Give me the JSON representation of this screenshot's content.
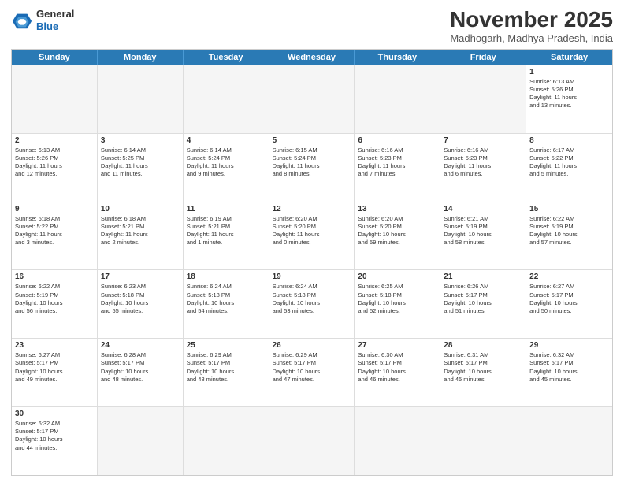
{
  "header": {
    "logo_general": "General",
    "logo_blue": "Blue",
    "month_title": "November 2025",
    "subtitle": "Madhogarh, Madhya Pradesh, India"
  },
  "day_headers": [
    "Sunday",
    "Monday",
    "Tuesday",
    "Wednesday",
    "Thursday",
    "Friday",
    "Saturday"
  ],
  "weeks": [
    [
      {
        "day": "",
        "info": ""
      },
      {
        "day": "",
        "info": ""
      },
      {
        "day": "",
        "info": ""
      },
      {
        "day": "",
        "info": ""
      },
      {
        "day": "",
        "info": ""
      },
      {
        "day": "",
        "info": ""
      },
      {
        "day": "1",
        "info": "Sunrise: 6:13 AM\nSunset: 5:26 PM\nDaylight: 11 hours\nand 13 minutes."
      }
    ],
    [
      {
        "day": "2",
        "info": "Sunrise: 6:13 AM\nSunset: 5:26 PM\nDaylight: 11 hours\nand 12 minutes."
      },
      {
        "day": "3",
        "info": "Sunrise: 6:14 AM\nSunset: 5:25 PM\nDaylight: 11 hours\nand 11 minutes."
      },
      {
        "day": "4",
        "info": "Sunrise: 6:14 AM\nSunset: 5:24 PM\nDaylight: 11 hours\nand 9 minutes."
      },
      {
        "day": "5",
        "info": "Sunrise: 6:15 AM\nSunset: 5:24 PM\nDaylight: 11 hours\nand 8 minutes."
      },
      {
        "day": "6",
        "info": "Sunrise: 6:16 AM\nSunset: 5:23 PM\nDaylight: 11 hours\nand 7 minutes."
      },
      {
        "day": "7",
        "info": "Sunrise: 6:16 AM\nSunset: 5:23 PM\nDaylight: 11 hours\nand 6 minutes."
      },
      {
        "day": "8",
        "info": "Sunrise: 6:17 AM\nSunset: 5:22 PM\nDaylight: 11 hours\nand 5 minutes."
      }
    ],
    [
      {
        "day": "9",
        "info": "Sunrise: 6:18 AM\nSunset: 5:22 PM\nDaylight: 11 hours\nand 3 minutes."
      },
      {
        "day": "10",
        "info": "Sunrise: 6:18 AM\nSunset: 5:21 PM\nDaylight: 11 hours\nand 2 minutes."
      },
      {
        "day": "11",
        "info": "Sunrise: 6:19 AM\nSunset: 5:21 PM\nDaylight: 11 hours\nand 1 minute."
      },
      {
        "day": "12",
        "info": "Sunrise: 6:20 AM\nSunset: 5:20 PM\nDaylight: 11 hours\nand 0 minutes."
      },
      {
        "day": "13",
        "info": "Sunrise: 6:20 AM\nSunset: 5:20 PM\nDaylight: 10 hours\nand 59 minutes."
      },
      {
        "day": "14",
        "info": "Sunrise: 6:21 AM\nSunset: 5:19 PM\nDaylight: 10 hours\nand 58 minutes."
      },
      {
        "day": "15",
        "info": "Sunrise: 6:22 AM\nSunset: 5:19 PM\nDaylight: 10 hours\nand 57 minutes."
      }
    ],
    [
      {
        "day": "16",
        "info": "Sunrise: 6:22 AM\nSunset: 5:19 PM\nDaylight: 10 hours\nand 56 minutes."
      },
      {
        "day": "17",
        "info": "Sunrise: 6:23 AM\nSunset: 5:18 PM\nDaylight: 10 hours\nand 55 minutes."
      },
      {
        "day": "18",
        "info": "Sunrise: 6:24 AM\nSunset: 5:18 PM\nDaylight: 10 hours\nand 54 minutes."
      },
      {
        "day": "19",
        "info": "Sunrise: 6:24 AM\nSunset: 5:18 PM\nDaylight: 10 hours\nand 53 minutes."
      },
      {
        "day": "20",
        "info": "Sunrise: 6:25 AM\nSunset: 5:18 PM\nDaylight: 10 hours\nand 52 minutes."
      },
      {
        "day": "21",
        "info": "Sunrise: 6:26 AM\nSunset: 5:17 PM\nDaylight: 10 hours\nand 51 minutes."
      },
      {
        "day": "22",
        "info": "Sunrise: 6:27 AM\nSunset: 5:17 PM\nDaylight: 10 hours\nand 50 minutes."
      }
    ],
    [
      {
        "day": "23",
        "info": "Sunrise: 6:27 AM\nSunset: 5:17 PM\nDaylight: 10 hours\nand 49 minutes."
      },
      {
        "day": "24",
        "info": "Sunrise: 6:28 AM\nSunset: 5:17 PM\nDaylight: 10 hours\nand 48 minutes."
      },
      {
        "day": "25",
        "info": "Sunrise: 6:29 AM\nSunset: 5:17 PM\nDaylight: 10 hours\nand 48 minutes."
      },
      {
        "day": "26",
        "info": "Sunrise: 6:29 AM\nSunset: 5:17 PM\nDaylight: 10 hours\nand 47 minutes."
      },
      {
        "day": "27",
        "info": "Sunrise: 6:30 AM\nSunset: 5:17 PM\nDaylight: 10 hours\nand 46 minutes."
      },
      {
        "day": "28",
        "info": "Sunrise: 6:31 AM\nSunset: 5:17 PM\nDaylight: 10 hours\nand 45 minutes."
      },
      {
        "day": "29",
        "info": "Sunrise: 6:32 AM\nSunset: 5:17 PM\nDaylight: 10 hours\nand 45 minutes."
      }
    ],
    [
      {
        "day": "30",
        "info": "Sunrise: 6:32 AM\nSunset: 5:17 PM\nDaylight: 10 hours\nand 44 minutes."
      },
      {
        "day": "",
        "info": ""
      },
      {
        "day": "",
        "info": ""
      },
      {
        "day": "",
        "info": ""
      },
      {
        "day": "",
        "info": ""
      },
      {
        "day": "",
        "info": ""
      },
      {
        "day": "",
        "info": ""
      }
    ]
  ]
}
